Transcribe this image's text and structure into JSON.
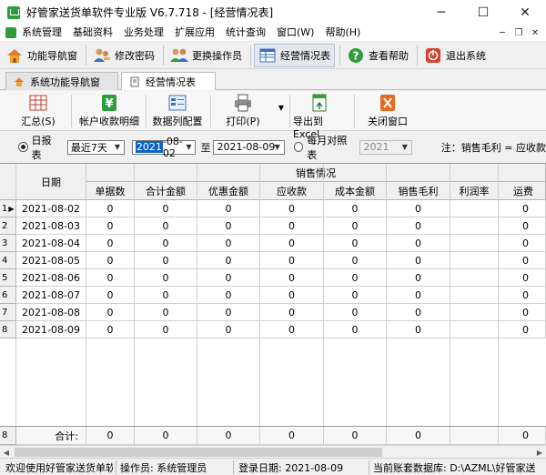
{
  "window": {
    "title": "好管家送货单软件专业版 V6.7.718 - [经营情况表]",
    "min": "─",
    "max": "☐",
    "close": "✕"
  },
  "menu": {
    "items": [
      "系统管理",
      "基础资料",
      "业务处理",
      "扩展应用",
      "统计查询",
      "窗口(W)",
      "帮助(H)"
    ],
    "mdi": {
      "min": "─",
      "restore": "❐",
      "close": "✕"
    }
  },
  "toolbar": {
    "buttons": [
      "功能导航窗",
      "修改密码",
      "更换操作员",
      "经营情况表",
      "查看帮助",
      "退出系统"
    ]
  },
  "tabs": [
    "系统功能导航窗",
    "经营情况表"
  ],
  "actions": {
    "summary": "汇总(S)",
    "account_detail": "帐户收款明细",
    "column_config": "数据列配置",
    "print": "打印(P)",
    "print_dropdown": "▼",
    "export_excel": "导出到Excel",
    "close_window": "关闭窗口"
  },
  "filters": {
    "daily_label": "日报表",
    "range_value": "最近7天",
    "start_year_sel": "2021",
    "start_rest": "-08-02",
    "to_label": "至",
    "end_date": "2021-08-09",
    "monthly_label": "每月对照表",
    "monthly_year": "2021",
    "note": "注：销售毛利 = 应收款"
  },
  "grid": {
    "date_header": "日期",
    "group_header": "销售情况",
    "columns": [
      "单据数",
      "合计金额",
      "优惠金额",
      "应收款",
      "成本金额",
      "销售毛利",
      "利润率",
      "运费"
    ],
    "rows": [
      {
        "num": "1",
        "date": "2021-08-02",
        "values": [
          "0",
          "0",
          "0",
          "0",
          "0",
          "0",
          "",
          "0"
        ]
      },
      {
        "num": "2",
        "date": "2021-08-03",
        "values": [
          "0",
          "0",
          "0",
          "0",
          "0",
          "0",
          "",
          "0"
        ]
      },
      {
        "num": "3",
        "date": "2021-08-04",
        "values": [
          "0",
          "0",
          "0",
          "0",
          "0",
          "0",
          "",
          "0"
        ]
      },
      {
        "num": "4",
        "date": "2021-08-05",
        "values": [
          "0",
          "0",
          "0",
          "0",
          "0",
          "0",
          "",
          "0"
        ]
      },
      {
        "num": "5",
        "date": "2021-08-06",
        "values": [
          "0",
          "0",
          "0",
          "0",
          "0",
          "0",
          "",
          "0"
        ]
      },
      {
        "num": "6",
        "date": "2021-08-07",
        "values": [
          "0",
          "0",
          "0",
          "0",
          "0",
          "0",
          "",
          "0"
        ]
      },
      {
        "num": "7",
        "date": "2021-08-08",
        "values": [
          "0",
          "0",
          "0",
          "0",
          "0",
          "0",
          "",
          "0"
        ]
      },
      {
        "num": "8",
        "date": "2021-08-09",
        "values": [
          "0",
          "0",
          "0",
          "0",
          "0",
          "0",
          "",
          "0"
        ]
      }
    ],
    "total": {
      "num": "8",
      "label": "合计:",
      "values": [
        "0",
        "0",
        "0",
        "0",
        "0",
        "0",
        "",
        "0"
      ]
    }
  },
  "status": {
    "welcome": "欢迎使用好管家送货单软件",
    "operator": "操作员: 系统管理员",
    "login_date": "登录日期: 2021-08-09",
    "database": "当前账套数据库: D:\\AZML\\好管家送"
  },
  "colors": {
    "accent": "#0a64c8",
    "grid_line": "#d0d0d0",
    "header_bg": "#f0f0f0"
  }
}
